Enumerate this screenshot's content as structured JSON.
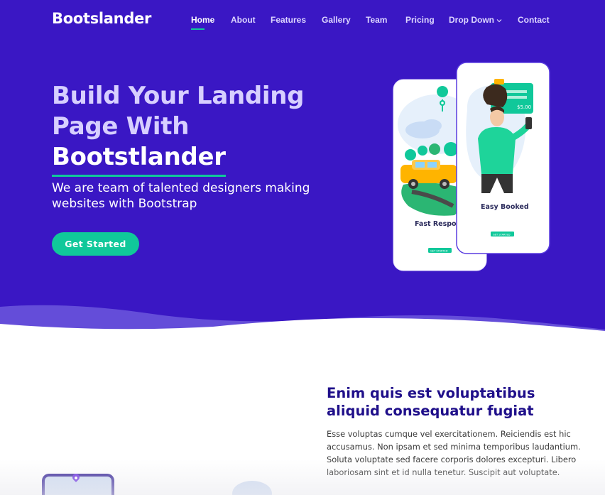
{
  "brand": "Bootslander",
  "nav": {
    "items": [
      "Home",
      "About",
      "Features",
      "Gallery",
      "Team",
      "Pricing",
      "Drop Down",
      "Contact"
    ],
    "active": "Home"
  },
  "hero": {
    "title_line1": "Build Your Landing",
    "title_line2": "Page With",
    "title_highlight": "Bootstlander",
    "subtitle": "We are team of talented designers making websites with Bootstrap",
    "cta": "Get Started",
    "phone_left_caption": "Fast Respon",
    "phone_left_button": "GET STARTED",
    "phone_right_caption": "Easy Booked",
    "phone_right_button": "GET STARTED",
    "phone_right_price": "$5.00"
  },
  "about": {
    "title": "Enim quis est voluptatibus aliquid consequatur fugiat",
    "text": "Esse voluptas cumque vel exercitationem. Reiciendis est hic accusamus. Non ipsam et sed minima temporibus laudantium. Soluta voluptate sed facere corporis dolores excepturi. Libero laboriosam sint et id nulla tenetur. Suscipit aut voluptate."
  },
  "colors": {
    "hero_bg": "#3a17c4",
    "accent": "#10c89a",
    "title_dark": "#1f0f8a"
  }
}
